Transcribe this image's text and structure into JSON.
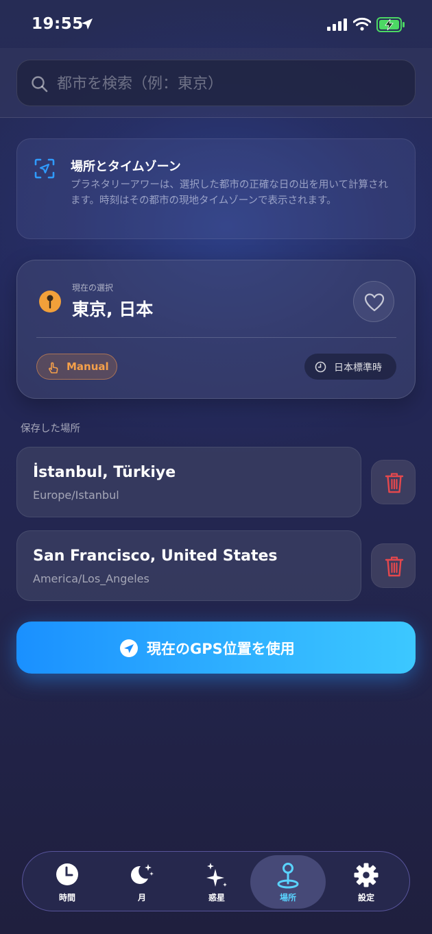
{
  "status_bar": {
    "time": "19:55"
  },
  "search": {
    "placeholder": "都市を検索（例：東京）",
    "value": ""
  },
  "info": {
    "title": "場所とタイムゾーン",
    "body": "プラネタリーアワーは、選択した都市の正確な日の出を用いて計算されます。時刻はその都市の現地タイムゾーンで表示されます。"
  },
  "current": {
    "label": "現在の選択",
    "city": "東京, 日本",
    "mode": "Manual",
    "timezone": "日本標準時"
  },
  "saved": {
    "header": "保存した場所",
    "items": [
      {
        "name": "İstanbul, Türkiye",
        "timezone": "Europe/Istanbul"
      },
      {
        "name": "San Francisco, United States",
        "timezone": "America/Los_Angeles"
      }
    ]
  },
  "gps_button": {
    "label": "現在のGPS位置を使用"
  },
  "tabs": [
    {
      "label": "時間",
      "icon": "clock-icon"
    },
    {
      "label": "月",
      "icon": "moon-stars-icon"
    },
    {
      "label": "惑星",
      "icon": "sparkles-icon"
    },
    {
      "label": "場所",
      "icon": "map-pin-icon",
      "active": true
    },
    {
      "label": "設定",
      "icon": "gear-icon"
    }
  ],
  "colors": {
    "accent": "#2fb0ff",
    "pin": "#f2a03a",
    "delete": "#e5484d",
    "active_tab": "#5ad4ff"
  }
}
